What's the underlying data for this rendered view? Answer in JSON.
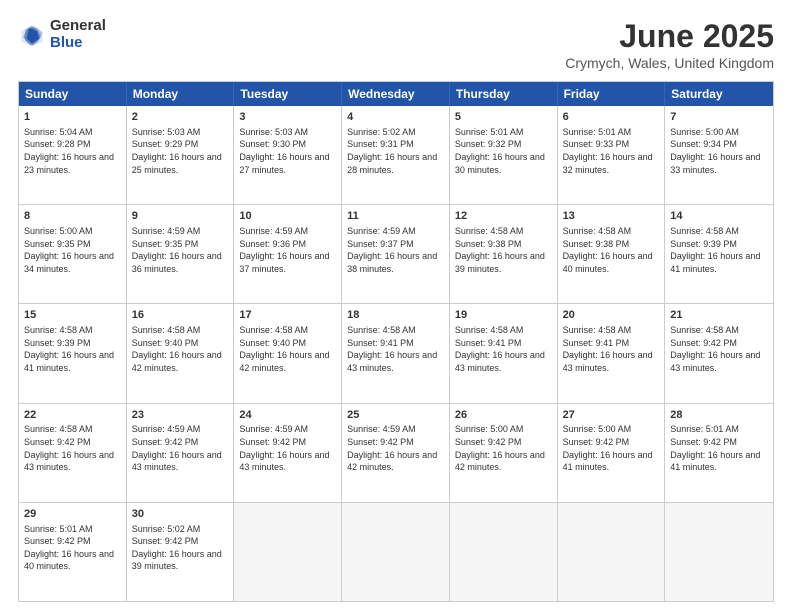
{
  "header": {
    "logo_general": "General",
    "logo_blue": "Blue",
    "month_title": "June 2025",
    "location": "Crymych, Wales, United Kingdom"
  },
  "calendar": {
    "days_of_week": [
      "Sunday",
      "Monday",
      "Tuesday",
      "Wednesday",
      "Thursday",
      "Friday",
      "Saturday"
    ],
    "weeks": [
      [
        {
          "day": "",
          "empty": true
        },
        {
          "day": "",
          "empty": true
        },
        {
          "day": "",
          "empty": true
        },
        {
          "day": "",
          "empty": true
        },
        {
          "day": "",
          "empty": true
        },
        {
          "day": "",
          "empty": true
        },
        {
          "day": "",
          "empty": true
        }
      ],
      [
        {
          "day": "1",
          "sunrise": "5:04 AM",
          "sunset": "9:28 PM",
          "daylight": "16 hours and 23 minutes."
        },
        {
          "day": "2",
          "sunrise": "5:03 AM",
          "sunset": "9:29 PM",
          "daylight": "16 hours and 25 minutes."
        },
        {
          "day": "3",
          "sunrise": "5:03 AM",
          "sunset": "9:30 PM",
          "daylight": "16 hours and 27 minutes."
        },
        {
          "day": "4",
          "sunrise": "5:02 AM",
          "sunset": "9:31 PM",
          "daylight": "16 hours and 28 minutes."
        },
        {
          "day": "5",
          "sunrise": "5:01 AM",
          "sunset": "9:32 PM",
          "daylight": "16 hours and 30 minutes."
        },
        {
          "day": "6",
          "sunrise": "5:01 AM",
          "sunset": "9:33 PM",
          "daylight": "16 hours and 32 minutes."
        },
        {
          "day": "7",
          "sunrise": "5:00 AM",
          "sunset": "9:34 PM",
          "daylight": "16 hours and 33 minutes."
        }
      ],
      [
        {
          "day": "8",
          "sunrise": "5:00 AM",
          "sunset": "9:35 PM",
          "daylight": "16 hours and 34 minutes."
        },
        {
          "day": "9",
          "sunrise": "4:59 AM",
          "sunset": "9:35 PM",
          "daylight": "16 hours and 36 minutes."
        },
        {
          "day": "10",
          "sunrise": "4:59 AM",
          "sunset": "9:36 PM",
          "daylight": "16 hours and 37 minutes."
        },
        {
          "day": "11",
          "sunrise": "4:59 AM",
          "sunset": "9:37 PM",
          "daylight": "16 hours and 38 minutes."
        },
        {
          "day": "12",
          "sunrise": "4:58 AM",
          "sunset": "9:38 PM",
          "daylight": "16 hours and 39 minutes."
        },
        {
          "day": "13",
          "sunrise": "4:58 AM",
          "sunset": "9:38 PM",
          "daylight": "16 hours and 40 minutes."
        },
        {
          "day": "14",
          "sunrise": "4:58 AM",
          "sunset": "9:39 PM",
          "daylight": "16 hours and 41 minutes."
        }
      ],
      [
        {
          "day": "15",
          "sunrise": "4:58 AM",
          "sunset": "9:39 PM",
          "daylight": "16 hours and 41 minutes."
        },
        {
          "day": "16",
          "sunrise": "4:58 AM",
          "sunset": "9:40 PM",
          "daylight": "16 hours and 42 minutes."
        },
        {
          "day": "17",
          "sunrise": "4:58 AM",
          "sunset": "9:40 PM",
          "daylight": "16 hours and 42 minutes."
        },
        {
          "day": "18",
          "sunrise": "4:58 AM",
          "sunset": "9:41 PM",
          "daylight": "16 hours and 43 minutes."
        },
        {
          "day": "19",
          "sunrise": "4:58 AM",
          "sunset": "9:41 PM",
          "daylight": "16 hours and 43 minutes."
        },
        {
          "day": "20",
          "sunrise": "4:58 AM",
          "sunset": "9:41 PM",
          "daylight": "16 hours and 43 minutes."
        },
        {
          "day": "21",
          "sunrise": "4:58 AM",
          "sunset": "9:42 PM",
          "daylight": "16 hours and 43 minutes."
        }
      ],
      [
        {
          "day": "22",
          "sunrise": "4:58 AM",
          "sunset": "9:42 PM",
          "daylight": "16 hours and 43 minutes."
        },
        {
          "day": "23",
          "sunrise": "4:59 AM",
          "sunset": "9:42 PM",
          "daylight": "16 hours and 43 minutes."
        },
        {
          "day": "24",
          "sunrise": "4:59 AM",
          "sunset": "9:42 PM",
          "daylight": "16 hours and 43 minutes."
        },
        {
          "day": "25",
          "sunrise": "4:59 AM",
          "sunset": "9:42 PM",
          "daylight": "16 hours and 42 minutes."
        },
        {
          "day": "26",
          "sunrise": "5:00 AM",
          "sunset": "9:42 PM",
          "daylight": "16 hours and 42 minutes."
        },
        {
          "day": "27",
          "sunrise": "5:00 AM",
          "sunset": "9:42 PM",
          "daylight": "16 hours and 41 minutes."
        },
        {
          "day": "28",
          "sunrise": "5:01 AM",
          "sunset": "9:42 PM",
          "daylight": "16 hours and 41 minutes."
        }
      ],
      [
        {
          "day": "29",
          "sunrise": "5:01 AM",
          "sunset": "9:42 PM",
          "daylight": "16 hours and 40 minutes."
        },
        {
          "day": "30",
          "sunrise": "5:02 AM",
          "sunset": "9:42 PM",
          "daylight": "16 hours and 39 minutes."
        },
        {
          "day": "",
          "empty": true
        },
        {
          "day": "",
          "empty": true
        },
        {
          "day": "",
          "empty": true
        },
        {
          "day": "",
          "empty": true
        },
        {
          "day": "",
          "empty": true
        }
      ]
    ]
  }
}
